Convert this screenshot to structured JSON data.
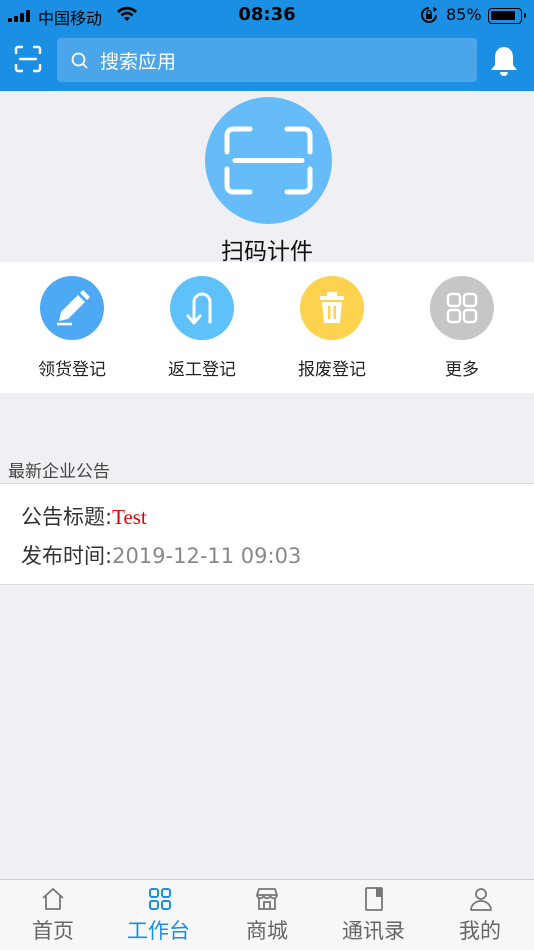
{
  "status_bar": {
    "carrier": "中国移动",
    "time": "08:36",
    "battery": "85%"
  },
  "header": {
    "search_placeholder": "搜索应用",
    "search_icon": "search-icon",
    "scan_icon": "scan-icon",
    "bell_icon": "bell-icon"
  },
  "hero": {
    "title": "扫码计件",
    "icon": "scan-icon",
    "color": "#66bbf9"
  },
  "quick_actions": [
    {
      "label": "领货登记",
      "icon": "pencil-icon",
      "color": "#4ea9f5"
    },
    {
      "label": "返工登记",
      "icon": "u-turn-icon",
      "color": "#5ec1f9"
    },
    {
      "label": "报废登记",
      "icon": "trash-icon",
      "color": "#fdd24f"
    },
    {
      "label": "更多",
      "icon": "grid-icon",
      "color": "#c6c6c6"
    }
  ],
  "announcements": {
    "section_title": "最新企业公告",
    "items": [
      {
        "title_label": "公告标题:",
        "title_value": "Test",
        "time_label": "发布时间:",
        "time_value": "2019-12-11 09:03"
      }
    ]
  },
  "tab_bar": {
    "active_index": 1,
    "tabs": [
      {
        "label": "首页",
        "icon": "home-icon"
      },
      {
        "label": "工作台",
        "icon": "workbench-icon"
      },
      {
        "label": "商城",
        "icon": "store-icon"
      },
      {
        "label": "通讯录",
        "icon": "contacts-icon"
      },
      {
        "label": "我的",
        "icon": "profile-icon"
      }
    ]
  },
  "colors": {
    "primary": "#1a8fe3",
    "search_bg": "#4aa5ea",
    "notice_title": "#e60000",
    "page_bg": "#efeff4"
  }
}
